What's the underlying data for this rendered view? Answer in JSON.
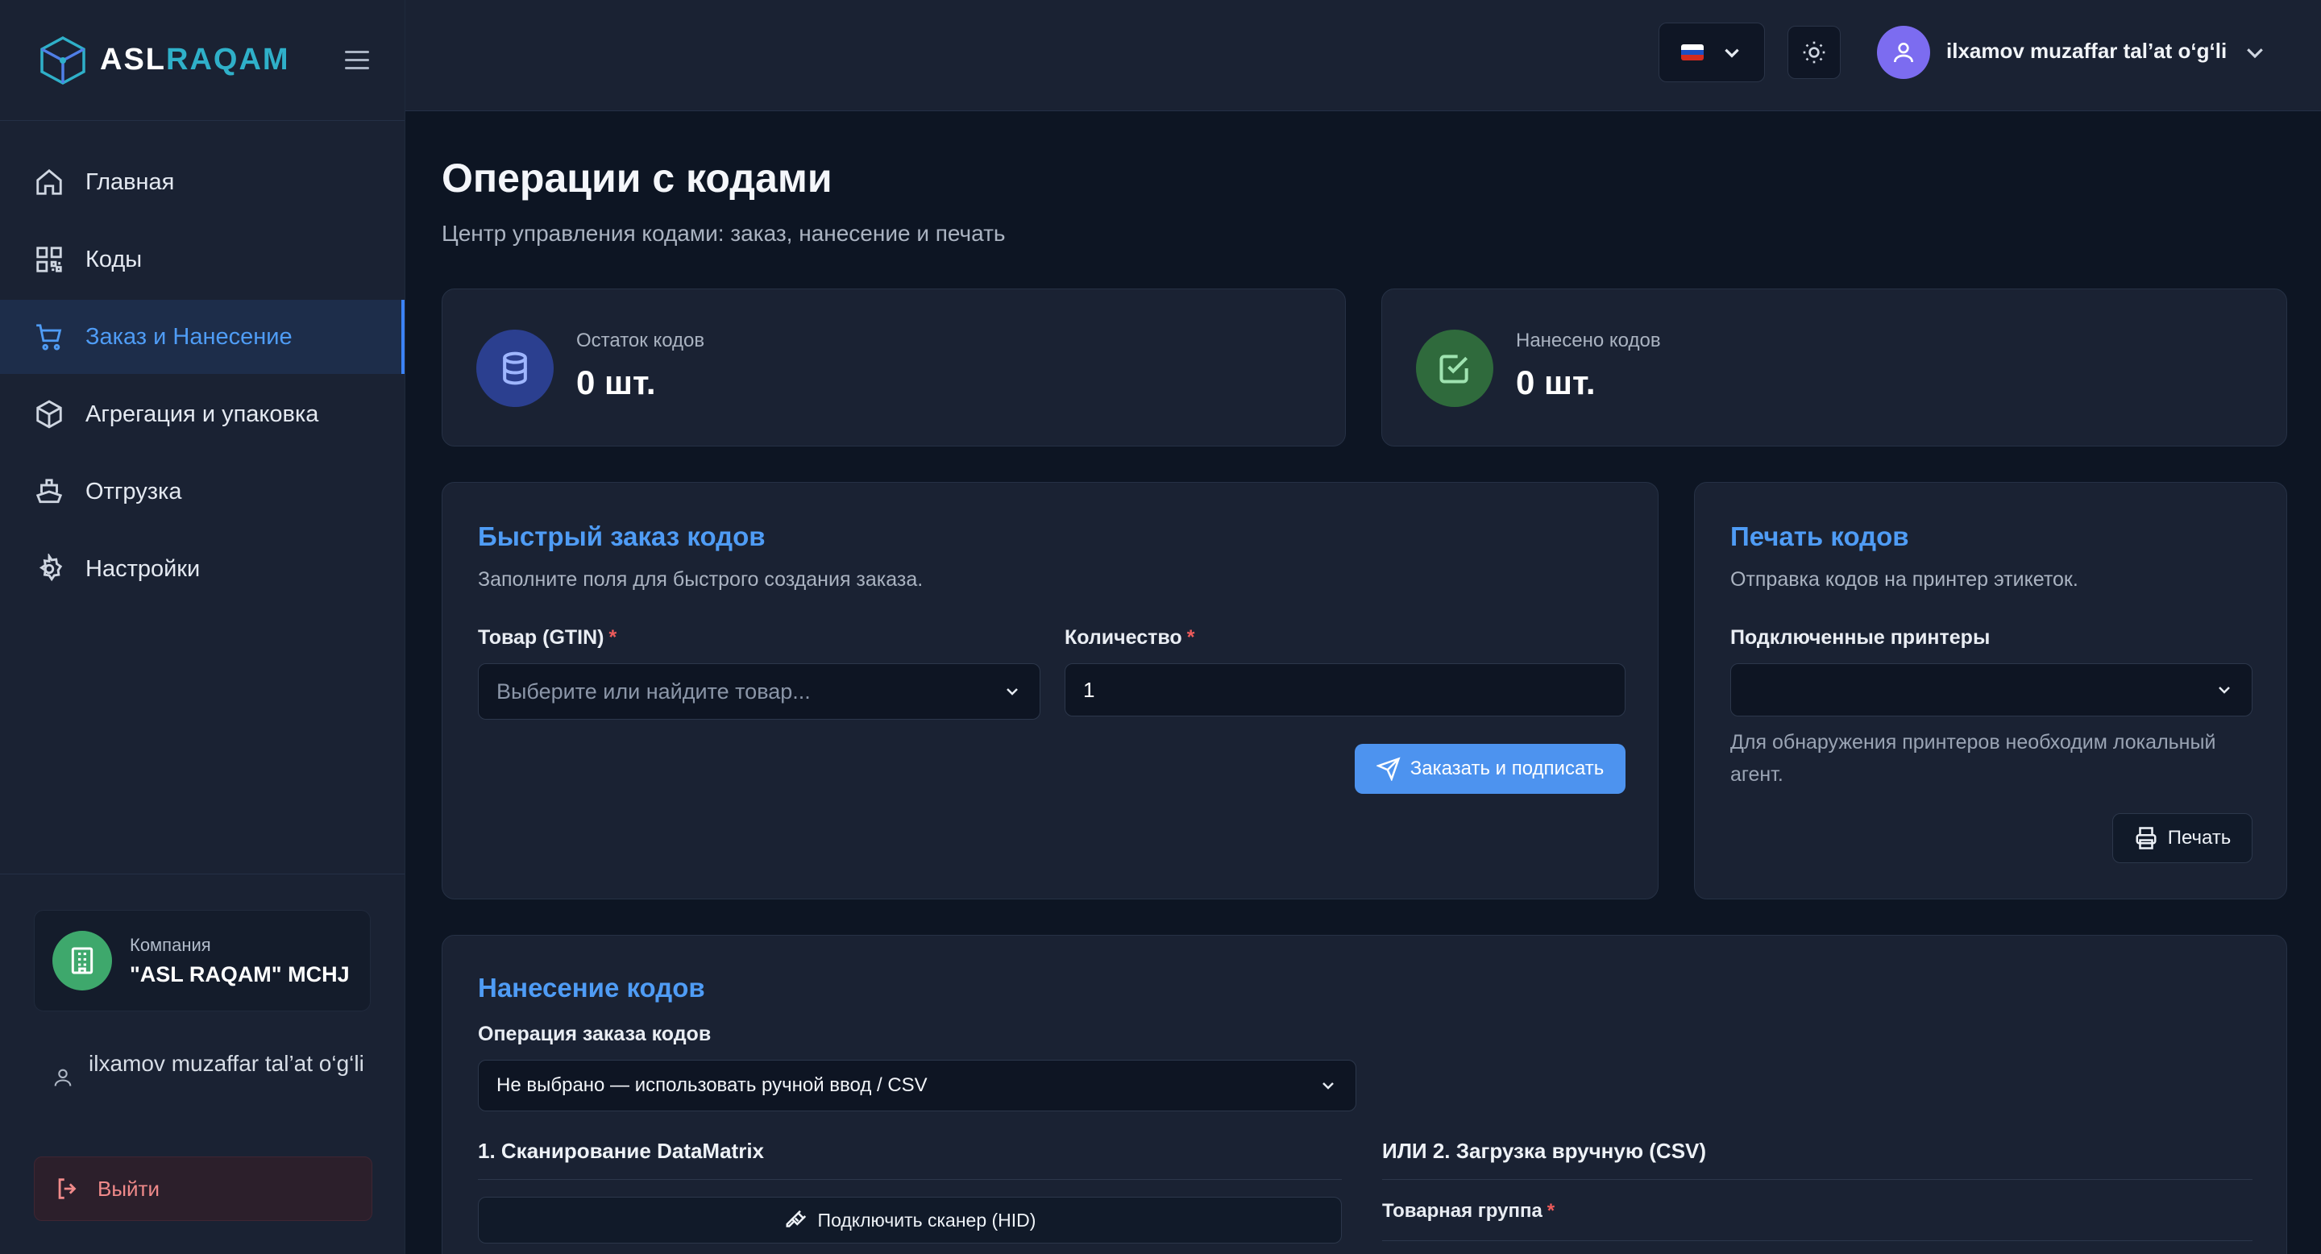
{
  "brand": {
    "name_part1": "ASL",
    "name_part2": "RAQAM"
  },
  "sidebar": {
    "items": [
      {
        "label": "Главная",
        "icon": "home-icon"
      },
      {
        "label": "Коды",
        "icon": "qr-code-icon"
      },
      {
        "label": "Заказ и Нанесение",
        "icon": "cart-icon",
        "active": true
      },
      {
        "label": "Агрегация и упаковка",
        "icon": "package-icon"
      },
      {
        "label": "Отгрузка",
        "icon": "ship-icon"
      },
      {
        "label": "Настройки",
        "icon": "gear-icon"
      }
    ],
    "company_label": "Компания",
    "company_name": "\"ASL RAQAM\" MCHJ",
    "user_name": "ilxamov muzaffar tal’at o‘g‘li",
    "logout_label": "Выйти"
  },
  "header": {
    "user_name": "ilxamov muzaffar tal’at o‘g‘li",
    "language_flag": "russia-flag-icon"
  },
  "page": {
    "title": "Операции с кодами",
    "subtitle": "Центр управления кодами: заказ, нанесение и печать"
  },
  "stats": {
    "remaining_label": "Остаток кодов",
    "remaining_value": "0 шт.",
    "applied_label": "Нанесено кодов",
    "applied_value": "0 шт."
  },
  "quick_order": {
    "title": "Быстрый заказ кодов",
    "description": "Заполните поля для быстрого создания заказа.",
    "product_label": "Товар (GTIN)",
    "product_placeholder": "Выберите или найдите товар...",
    "quantity_label": "Количество",
    "quantity_value": "1",
    "submit_label": "Заказать и подписать",
    "required_mark": "*"
  },
  "print": {
    "title": "Печать кодов",
    "description": "Отправка кодов на принтер этикеток.",
    "printers_label": "Подключенные принтеры",
    "printers_value": "",
    "hint": "Для обнаружения принтеров необходим локальный агент.",
    "print_label": "Печать"
  },
  "apply": {
    "title": "Нанесение кодов",
    "operation_label": "Операция заказа кодов",
    "operation_value": "Не выбрано — использовать ручной ввод / CSV",
    "scan_heading": "1. Сканирование DataMatrix",
    "scanner_button": "Подключить сканер (HID)",
    "csv_heading": "ИЛИ 2. Загрузка вручную (CSV)",
    "product_group_label": "Товарная группа"
  },
  "colors": {
    "accent": "#4f9cf5",
    "brand_teal": "#2fb0c9",
    "stat_blue": "#2b3f8f",
    "stat_green": "#2f6a3c",
    "danger": "#f08a8a"
  }
}
